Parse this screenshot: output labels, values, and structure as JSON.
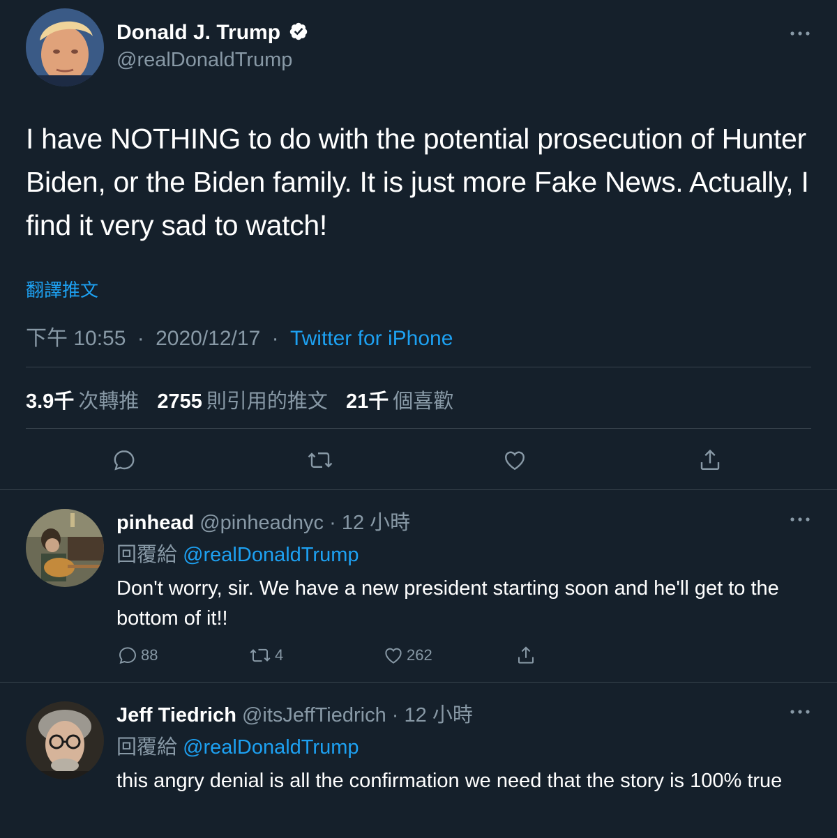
{
  "main_tweet": {
    "author_name": "Donald J. Trump",
    "verified": true,
    "handle": "@realDonaldTrump",
    "text": "I have NOTHING to do with the potential prosecution of Hunter Biden, or the Biden family. It is just more Fake News. Actually, I find it very sad to watch!",
    "translate_label": "翻譯推文",
    "time": "下午 10:55",
    "separator": "·",
    "date": "2020/12/17",
    "source": "Twitter for iPhone",
    "stats": {
      "retweets_value": "3.9千",
      "retweets_label": "次轉推",
      "quotes_value": "2755",
      "quotes_label": "則引用的推文",
      "likes_value": "21千",
      "likes_label": "個喜歡"
    },
    "actions": [
      "reply-icon",
      "retweet-icon",
      "like-icon",
      "share-icon"
    ]
  },
  "replies": [
    {
      "name": "pinhead",
      "handle": "@pinheadnyc",
      "separator": "·",
      "time": "12 小時",
      "replying_prefix": "回覆給",
      "replying_to": "@realDonaldTrump",
      "text": "Don't worry, sir.  We have a new president starting soon and he'll get to the bottom of it!!",
      "reply_count": "88",
      "retweet_count": "4",
      "like_count": "262"
    },
    {
      "name": "Jeff Tiedrich",
      "handle": "@itsJeffTiedrich",
      "separator": "·",
      "time": "12 小時",
      "replying_prefix": "回覆給",
      "replying_to": "@realDonaldTrump",
      "text": "this angry denial is all the confirmation we need that the story is 100% true"
    }
  ],
  "colors": {
    "background": "#15202b",
    "text_primary": "#ffffff",
    "text_secondary": "#8899a6",
    "accent": "#1da1f2",
    "divider": "#38444d"
  }
}
